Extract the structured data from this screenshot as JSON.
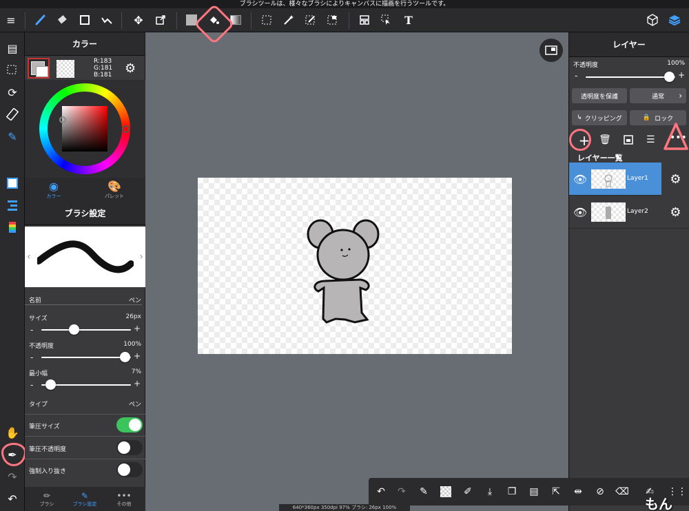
{
  "status_message": "ブラシツールは、様々なブラシによりキャンバスに描画を行うツールです。",
  "accent": "#4a90d9",
  "annotation_color": "#ff7580",
  "toolbar": {
    "menu_icon": "menu-icon",
    "brush_icon": "brush-icon",
    "eraser_icon": "eraser-icon",
    "shape_icon": "square-icon",
    "fx_icon": "filter-icon",
    "move_icon": "move-icon",
    "transform_icon": "transform-icon",
    "fill_color_icon": "fill-color-icon",
    "bucket_icon": "bucket-icon",
    "gradient_icon": "gradient-icon",
    "select_icon": "select-rect-icon",
    "magic_wand_icon": "magic-wand-icon",
    "select_pen_icon": "select-pen-icon",
    "select_eraser_icon": "select-eraser-icon",
    "frame_icon": "frame-icon",
    "operation_icon": "operation-icon",
    "text_label": "T",
    "material_icon": "material-icon",
    "layer_icon": "layer-stack-icon"
  },
  "color_panel": {
    "title": "カラー",
    "r": "R:183",
    "g": "G:181",
    "b": "B:181",
    "main_color": "#b7b5b5",
    "tabs": [
      {
        "label": "カラー"
      },
      {
        "label": "パレット"
      }
    ]
  },
  "brush_settings": {
    "title": "ブラシ設定",
    "name_label": "名前",
    "name_value": "ペン",
    "size_label": "サイズ",
    "size_value": "26px",
    "size_fraction": 0.26,
    "opacity_label": "不透明度",
    "opacity_value": "100%",
    "opacity_fraction": 1.0,
    "min_width_label": "最小幅",
    "min_width_value": "7%",
    "min_width_fraction": 0.07,
    "type_label": "タイプ",
    "type_value": "ペン",
    "pressure_size_label": "筆圧サイズ",
    "pressure_size_on": true,
    "pressure_opacity_label": "筆圧不透明度",
    "pressure_opacity_on": false,
    "forced_fade_label": "強制入り抜き",
    "forced_fade_on": false
  },
  "panel_tabs": [
    {
      "label": "ブラシ"
    },
    {
      "label": "ブラシ設定"
    },
    {
      "label": "その他"
    }
  ],
  "layer_panel": {
    "title": "レイヤー",
    "opacity_label": "不透明度",
    "opacity_value": "100%",
    "protect_label": "透明度を保護",
    "blend_label": "通常",
    "clipping_label": "クリッピング",
    "lock_label": "ロック",
    "list_title": "レイヤー一覧",
    "layers": [
      {
        "name": "Layer1",
        "selected": true
      },
      {
        "name": "Layer2",
        "selected": false
      }
    ]
  },
  "canvas_info": "640*360px 350dpi 97% ブラシ: 26px 100%",
  "watermark": "もん"
}
